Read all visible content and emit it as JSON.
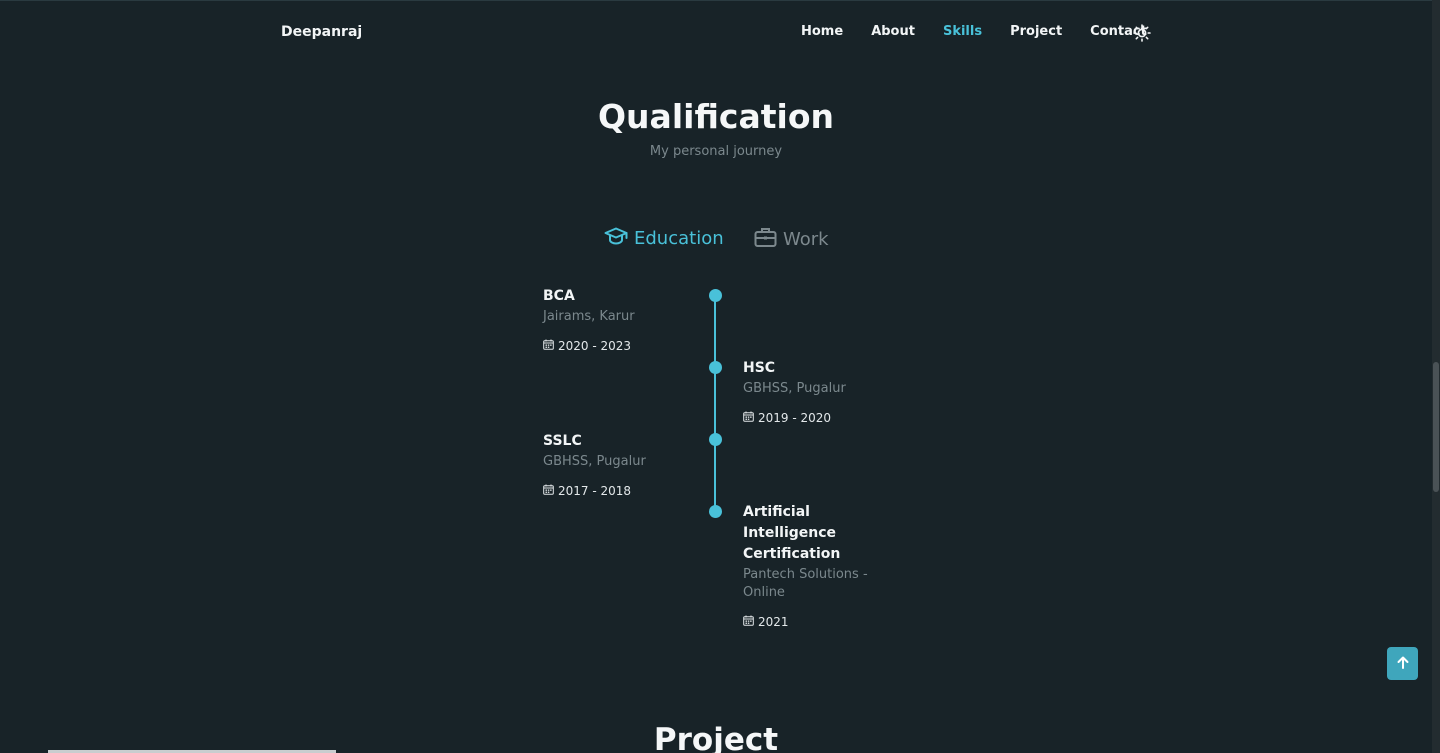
{
  "header": {
    "logo": "Deepanraj",
    "nav": [
      "Home",
      "About",
      "Skills",
      "Project",
      "Contact"
    ],
    "active_nav": "Skills"
  },
  "qualification": {
    "title": "Qualification",
    "subtitle": "My personal journey",
    "tabs": {
      "education": "Education",
      "work": "Work"
    },
    "active_tab": "Education",
    "items": [
      {
        "title": "BCA",
        "subtitle": "Jairams, Karur",
        "date": "2020 - 2023",
        "side": "left"
      },
      {
        "title": "HSC",
        "subtitle": "GBHSS, Pugalur",
        "date": "2019 - 2020",
        "side": "right"
      },
      {
        "title": "SSLC",
        "subtitle": "GBHSS, Pugalur",
        "date": "2017 - 2018",
        "side": "left"
      },
      {
        "title": "Artificial Intelligence Certification",
        "subtitle": "Pantech Solutions - Online",
        "date": "2021",
        "side": "right"
      }
    ]
  },
  "next_section": {
    "title": "Project"
  },
  "colors": {
    "background": "#182328",
    "accent": "#49c1d9",
    "muted": "#7b888d"
  },
  "icons": {
    "theme": "sun-icon",
    "education": "graduation-cap-icon",
    "work": "briefcase-icon",
    "date": "calendar-icon",
    "scroll": "arrow-up-icon"
  }
}
